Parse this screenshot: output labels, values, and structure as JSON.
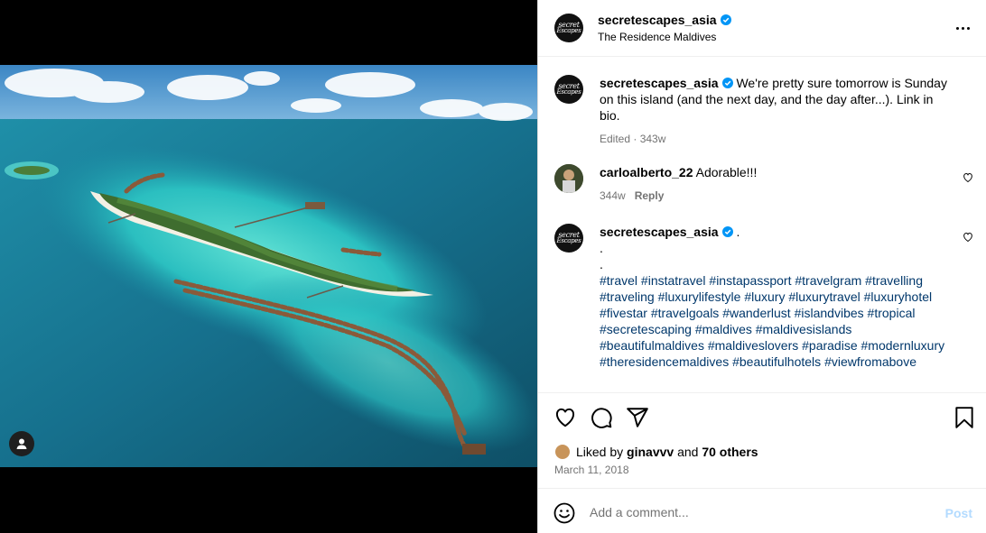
{
  "post": {
    "author": "secretescapes_asia",
    "avatar_text_line1": "secret",
    "avatar_text_line2": "Escapes",
    "location": "The Residence Maldives"
  },
  "comments": [
    {
      "user": "secretescapes_asia",
      "verified": true,
      "text": "We're pretty sure tomorrow is Sunday on this island (and the next day, and the day after...). Link in bio.",
      "meta_edited": "Edited",
      "meta_time": "343w"
    },
    {
      "user": "carloalberto_22",
      "text": "Adorable!!!",
      "time": "344w",
      "reply_label": "Reply"
    },
    {
      "user": "secretescapes_asia",
      "verified": true,
      "text_lines": [
        ".",
        ".",
        "."
      ],
      "hashtags": [
        "#travel",
        "#instatravel",
        "#instapassport",
        "#travelgram",
        "#travelling",
        "#traveling",
        "#luxurylifestyle",
        "#luxury",
        "#luxurytravel",
        "#luxuryhotel",
        "#fivestar",
        "#travelgoals",
        "#wanderlust",
        "#islandvibes",
        "#tropical",
        "#secretescaping",
        "#maldives",
        "#maldivesislands",
        "#beautifulmaldives",
        "#maldiveslovers",
        "#paradise",
        "#modernluxury",
        "#theresidencemaldives",
        "#beautifulhotels",
        "#viewfromabove"
      ]
    }
  ],
  "likes": {
    "prefix": "Liked by",
    "user": "ginavvv",
    "and": "and",
    "others": "70 others"
  },
  "date": "March 11, 2018",
  "add_comment": {
    "placeholder": "Add a comment...",
    "post_label": "Post"
  },
  "icons": [
    "more-icon",
    "verified-icon",
    "heart-icon",
    "comment-icon",
    "share-icon",
    "bookmark-icon",
    "emoji-icon",
    "user-tag-icon"
  ],
  "colors": {
    "accent": "#0095f6",
    "link": "#00376b",
    "muted": "#737373",
    "post_disabled": "#b3dbff"
  }
}
